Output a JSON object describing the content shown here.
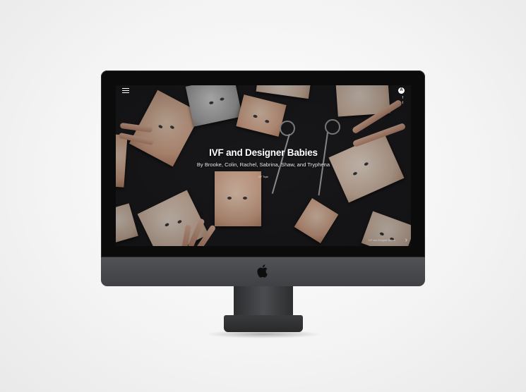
{
  "page": {
    "title": "IVF and Designer Babies",
    "byline": "By Brooke, Colin, Rachel, Sabrina, Shaw, and Tryphena",
    "scroll_link": "IVF Topic",
    "next_story": "IVF and Designer Babies"
  },
  "icons": {
    "menu": "hamburger-menu-icon",
    "brand": "A",
    "facebook": "f",
    "twitter": "t"
  },
  "colors": {
    "screen_bg": "#1c1c1f",
    "bezel": "#0b0b0b",
    "chassis": "#46484b",
    "title_text": "#ffffff"
  }
}
